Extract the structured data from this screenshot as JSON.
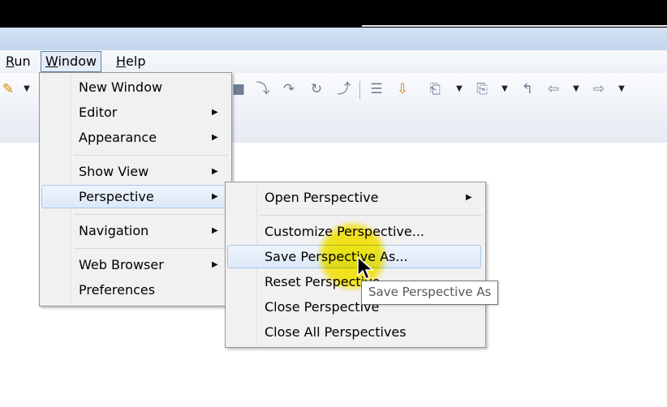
{
  "menubar": {
    "items": [
      {
        "label": "Run",
        "underline": "R"
      },
      {
        "label": "Window",
        "underline": "W"
      },
      {
        "label": "Help",
        "underline": "H"
      }
    ]
  },
  "window_menu": {
    "items": [
      {
        "label": "New Window"
      },
      {
        "label": "Editor"
      },
      {
        "label": "Appearance"
      },
      {
        "label": "Show View"
      },
      {
        "label": "Perspective"
      },
      {
        "label": "Navigation"
      },
      {
        "label": "Web Browser"
      },
      {
        "label": "Preferences"
      }
    ]
  },
  "perspective_menu": {
    "items": [
      {
        "label": "Open Perspective"
      },
      {
        "label": "Customize Perspective..."
      },
      {
        "label": "Save Perspective As..."
      },
      {
        "label": "Reset Perspective..."
      },
      {
        "label": "Close Perspective"
      },
      {
        "label": "Close All Perspectives"
      }
    ]
  },
  "tooltip": {
    "text": "Save Perspective As"
  },
  "colors": {
    "highlight": "#dde9f8",
    "highlight_border": "#a9c5e9",
    "cursor_highlight": "#ffec00"
  }
}
